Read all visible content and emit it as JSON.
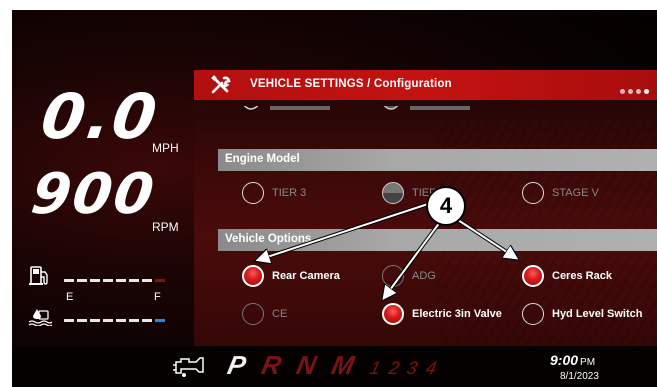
{
  "speed": {
    "value": "0.0",
    "unit": "MPH"
  },
  "rpm": {
    "value": "900",
    "unit": "RPM"
  },
  "fuel_gauge": {
    "icon": "fuel-pump-icon"
  },
  "def_gauge": {
    "icon": "def-fluid-icon",
    "empty_label": "E",
    "full_label": "F"
  },
  "panel": {
    "title": "VEHICLE SETTINGS / Configuration",
    "icon": "wrench-screwdriver-icon",
    "page_dots": 4,
    "active_page": 4,
    "sections": {
      "engine_model": {
        "label": "Engine Model",
        "options": [
          {
            "label": "TIER 3",
            "state": "unselected"
          },
          {
            "label": "TIER 4",
            "state": "partial"
          },
          {
            "label": "STAGE V",
            "state": "unselected"
          }
        ]
      },
      "vehicle_options": {
        "label": "Vehicle Options",
        "options": [
          {
            "label": "Rear Camera",
            "state": "checked"
          },
          {
            "label": "ADG",
            "state": "unselected"
          },
          {
            "label": "Ceres Rack",
            "state": "checked"
          },
          {
            "label": "CE",
            "state": "unselected"
          },
          {
            "label": "Electric 3in Valve",
            "state": "checked"
          },
          {
            "label": "Hyd Level Switch",
            "state": "unselected"
          }
        ]
      }
    }
  },
  "callout": {
    "number": "4"
  },
  "status_bar": {
    "engine_icon": "engine-warning-icon",
    "gears": [
      "P",
      "R",
      "N",
      "M"
    ],
    "active_gear": "P",
    "gear_numbers": [
      "1",
      "2",
      "3",
      "4"
    ],
    "time": "9:00",
    "ampm": "PM",
    "date": "8/1/2023"
  },
  "colors": {
    "accent": "#c41212",
    "section": "#a8a8a8",
    "checked": "#d41a1a"
  }
}
